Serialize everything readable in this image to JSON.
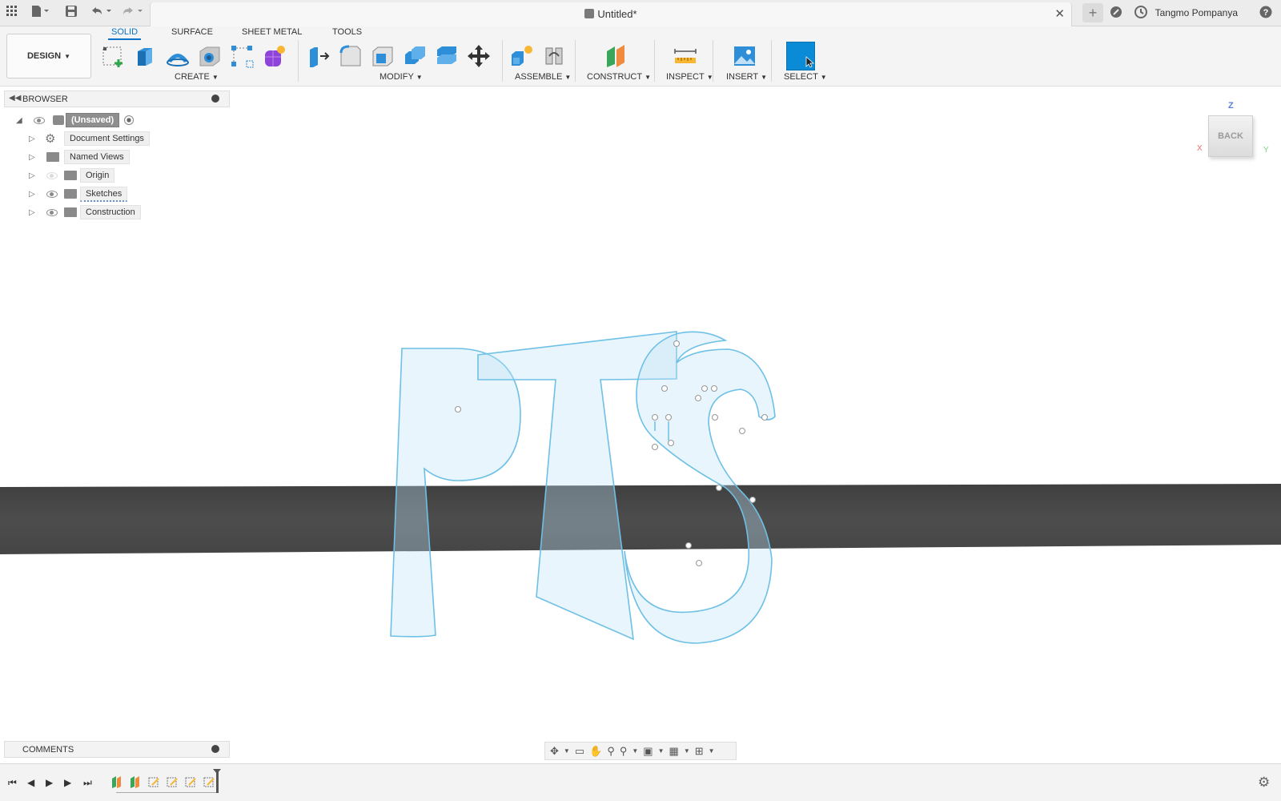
{
  "app": {
    "document_title": "Untitled*",
    "user_name": "Tangmo Pompanya"
  },
  "toolbar": {
    "workspace_label": "DESIGN",
    "tabs": [
      "SOLID",
      "SURFACE",
      "SHEET METAL",
      "TOOLS"
    ],
    "active_tab": "SOLID",
    "groups": {
      "create": "CREATE",
      "modify": "MODIFY",
      "assemble": "ASSEMBLE",
      "construct": "CONSTRUCT",
      "inspect": "INSPECT",
      "insert": "INSERT",
      "select": "SELECT"
    }
  },
  "browser": {
    "title": "BROWSER",
    "root": "(Unsaved)",
    "items": [
      "Document Settings",
      "Named Views",
      "Origin",
      "Sketches",
      "Construction"
    ]
  },
  "viewcube": {
    "face": "BACK",
    "axis_z": "Z",
    "axis_x": "X",
    "axis_y": "Y"
  },
  "comments": {
    "title": "COMMENTS"
  },
  "colors": {
    "accent": "#0a72c8",
    "sketch_line": "#6ec0e6",
    "sketch_fill": "#eaf5fb",
    "band": "#4b4b4b",
    "select_tool": "#0b8bd6"
  },
  "icons": [
    "apps-grid-icon",
    "file-icon",
    "save-icon",
    "undo-icon",
    "redo-icon",
    "new-tab-icon",
    "extensions-icon",
    "job-status-icon",
    "help-icon",
    "settings-icon"
  ]
}
